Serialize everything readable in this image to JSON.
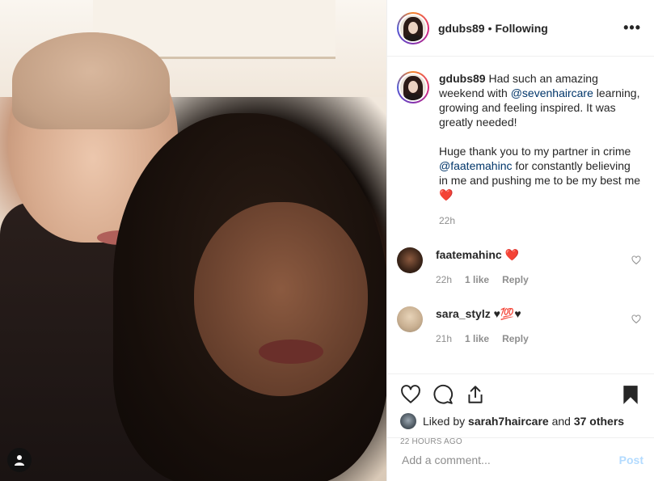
{
  "post": {
    "username": "gdubs89",
    "follow_status": "Following",
    "more_label": "•••"
  },
  "caption": {
    "username": "gdubs89",
    "p1_before": "Had such an amazing weekend with ",
    "p1_mention": "@sevenhaircare",
    "p1_after": " learning, growing and feeling inspired. It was greatly needed!",
    "p2_before": "Huge thank you to my partner in crime ",
    "p2_mention": "@faatemahinc",
    "p2_after": " for constantly believing in me and pushing me to be my best me ",
    "p2_emoji": "❤️",
    "time": "22h"
  },
  "comments": [
    {
      "username": "faatemahinc",
      "text": "❤️",
      "time": "22h",
      "likes": "1 like",
      "reply": "Reply"
    },
    {
      "username": "sara_stylz",
      "text": "♥💯♥",
      "time": "21h",
      "likes": "1 like",
      "reply": "Reply"
    }
  ],
  "likes": {
    "prefix": "Liked by ",
    "user": "sarah7haircare",
    "middle": " and ",
    "others": "37 others"
  },
  "posted_ago": "22 HOURS AGO",
  "comment_box": {
    "placeholder": "Add a comment...",
    "post_label": "Post"
  }
}
